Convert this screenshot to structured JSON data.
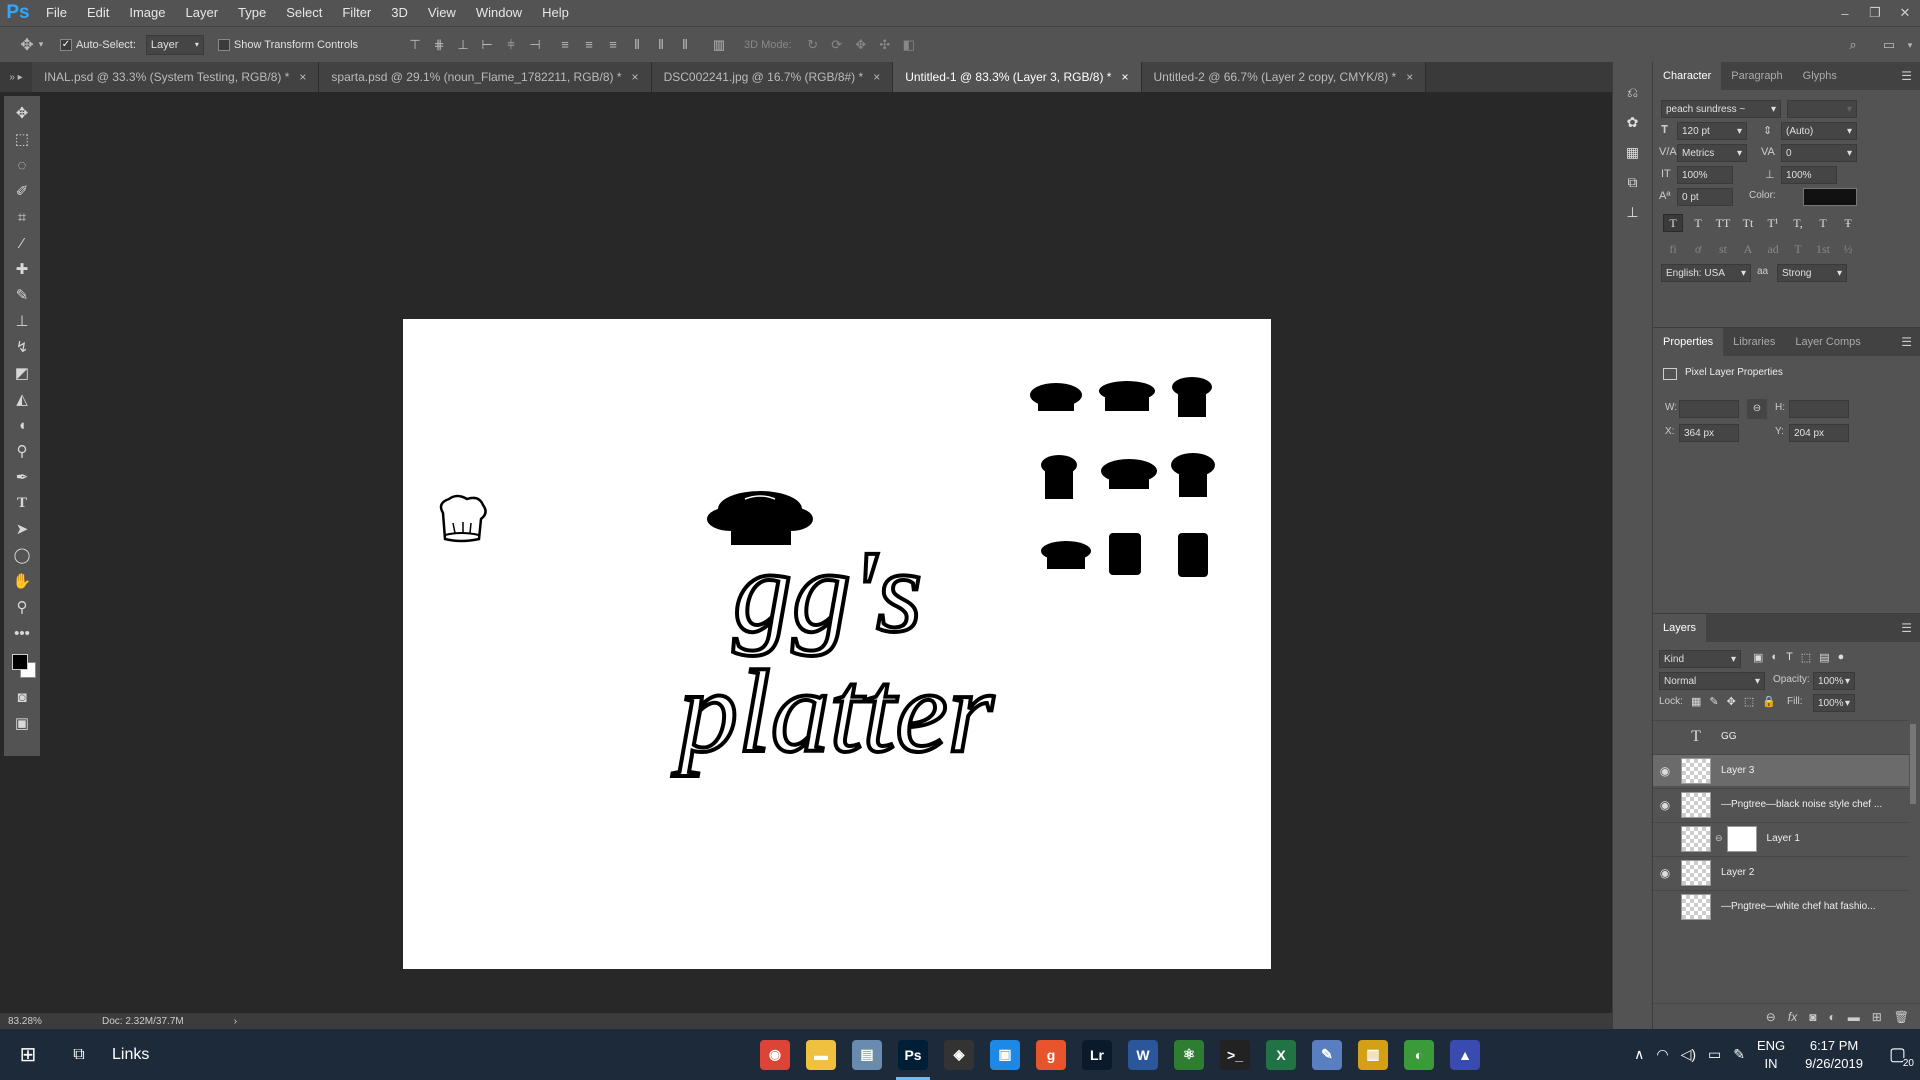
{
  "menubar": {
    "logo": "Ps",
    "items": [
      "File",
      "Edit",
      "Image",
      "Layer",
      "Type",
      "Select",
      "Filter",
      "3D",
      "View",
      "Window",
      "Help"
    ],
    "window_controls": [
      "–",
      "❐",
      "✕"
    ]
  },
  "options_bar": {
    "auto_select_label": "Auto-Select:",
    "auto_select_checked": true,
    "auto_select_target": "Layer",
    "show_transform_label": "Show Transform Controls",
    "show_transform_checked": false,
    "mode_3d_label": "3D Mode:"
  },
  "tabs": [
    {
      "label": "INAL.psd @ 33.3% (System  Testing, RGB/8) *",
      "active": false
    },
    {
      "label": "sparta.psd @ 29.1% (noun_Flame_1782211, RGB/8) *",
      "active": false
    },
    {
      "label": "DSC002241.jpg @ 16.7% (RGB/8#) *",
      "active": false
    },
    {
      "label": "Untitled-1 @ 83.3% (Layer 3, RGB/8) *",
      "active": true
    },
    {
      "label": "Untitled-2 @ 66.7% (Layer 2 copy, CMYK/8) *",
      "active": false
    }
  ],
  "canvas_text": {
    "line1": "gg's",
    "line2": "platter"
  },
  "status": {
    "zoom": "83.28%",
    "doc": "Doc: 2.32M/37.7M"
  },
  "character": {
    "tabs": [
      "Character",
      "Paragraph",
      "Glyphs"
    ],
    "font_family": "peach sundress ~",
    "font_size": "120 pt",
    "leading": "(Auto)",
    "kerning": "Metrics",
    "tracking": "0",
    "vscale": "100%",
    "hscale": "100%",
    "baseline": "0 pt",
    "color_label": "Color:",
    "color": "#111111",
    "language": "English: USA",
    "antialias": "Strong",
    "aa_label": "aa",
    "style_buttons": [
      "T",
      "T",
      "TT",
      "Tt",
      "T¹",
      "T,",
      "T",
      "Ŧ"
    ],
    "otf_buttons": [
      "fi",
      "ơ",
      "st",
      "A",
      "ad",
      "T",
      "1st",
      "½"
    ]
  },
  "properties": {
    "tabs": [
      "Properties",
      "Libraries",
      "Layer Comps"
    ],
    "title": "Pixel Layer Properties",
    "w_label": "W:",
    "h_label": "H:",
    "x_label": "X:",
    "y_label": "Y:",
    "w": "",
    "h": "",
    "x": "364 px",
    "y": "204 px"
  },
  "layers": {
    "tab": "Layers",
    "filter": "Kind",
    "blend": "Normal",
    "opacity_label": "Opacity:",
    "opacity": "100%",
    "lock_label": "Lock:",
    "fill_label": "Fill:",
    "fill": "100%",
    "rows": [
      {
        "name": "GG",
        "visible": false,
        "type": "text",
        "selected": false
      },
      {
        "name": "Layer 3",
        "visible": true,
        "type": "pixel",
        "selected": true
      },
      {
        "name": "—Pngtree—black noise style chef ...",
        "visible": true,
        "type": "smart",
        "selected": false
      },
      {
        "name": "Layer 1",
        "visible": false,
        "type": "mask",
        "selected": false
      },
      {
        "name": "Layer 2",
        "visible": true,
        "type": "pixel",
        "selected": false
      },
      {
        "name": "—Pngtree—white chef hat fashio...",
        "visible": false,
        "type": "pixel",
        "selected": false
      }
    ]
  },
  "taskbar": {
    "search_label": "Links",
    "apps": [
      {
        "name": "chrome",
        "glyph": "◉",
        "color": "#db4437",
        "active": false
      },
      {
        "name": "explorer",
        "glyph": "▬",
        "color": "#f0c040",
        "active": false
      },
      {
        "name": "scanner",
        "glyph": "▤",
        "color": "#6a8bb0",
        "active": false
      },
      {
        "name": "photoshop",
        "glyph": "Ps",
        "color": "#001e36",
        "active": true
      },
      {
        "name": "vpn",
        "glyph": "◈",
        "color": "#333",
        "active": false
      },
      {
        "name": "store",
        "glyph": "▣",
        "color": "#1e88e5",
        "active": false
      },
      {
        "name": "grammarly",
        "glyph": "g",
        "color": "#e8542c",
        "active": false
      },
      {
        "name": "lightroom",
        "glyph": "Lr",
        "color": "#0b1a2a",
        "active": false
      },
      {
        "name": "word",
        "glyph": "W",
        "color": "#2b579a",
        "active": false
      },
      {
        "name": "atom",
        "glyph": "⚛",
        "color": "#2e7d32",
        "active": false
      },
      {
        "name": "terminal",
        "glyph": ">_",
        "color": "#222",
        "active": false
      },
      {
        "name": "excel",
        "glyph": "X",
        "color": "#217346",
        "active": false
      },
      {
        "name": "paint",
        "glyph": "✎",
        "color": "#5a7fc0",
        "active": false
      },
      {
        "name": "files",
        "glyph": "▥",
        "color": "#d4a017",
        "active": false
      },
      {
        "name": "maps",
        "glyph": "◐",
        "color": "#3b9b3b",
        "active": false
      },
      {
        "name": "vector",
        "glyph": "▲",
        "color": "#3a4bb0",
        "active": false
      }
    ],
    "lang_top": "ENG",
    "lang_bottom": "IN",
    "time": "6:17 PM",
    "date": "9/26/2019",
    "notifications": "20"
  }
}
